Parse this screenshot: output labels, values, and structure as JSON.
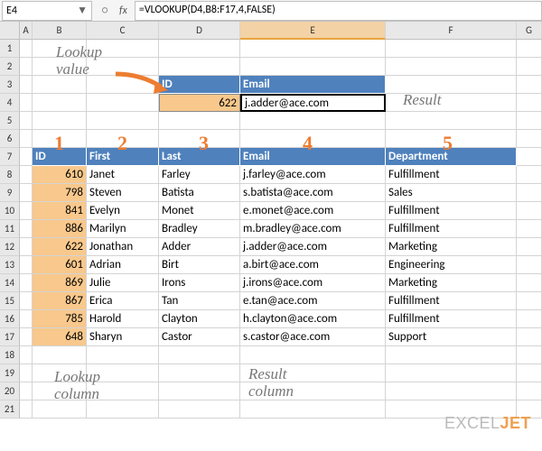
{
  "formula_bar": {
    "cell_ref": "E4",
    "fx_label": "fx",
    "formula": "=VLOOKUP(D4,B8:F17,4,FALSE)"
  },
  "columns": [
    "A",
    "B",
    "C",
    "D",
    "E",
    "F",
    "G"
  ],
  "rows": [
    "1",
    "2",
    "3",
    "4",
    "5",
    "6",
    "7",
    "8",
    "9",
    "10",
    "11",
    "12",
    "13",
    "14",
    "15",
    "16",
    "17",
    "18",
    "19",
    "20",
    "21"
  ],
  "lookup_header": {
    "id": "ID",
    "email": "Email"
  },
  "lookup_row": {
    "id": "622",
    "email": "j.adder@ace.com"
  },
  "table_header": {
    "id": "ID",
    "first": "First",
    "last": "Last",
    "email": "Email",
    "dept": "Department"
  },
  "table_rows": [
    {
      "id": "610",
      "first": "Janet",
      "last": "Farley",
      "email": "j.farley@ace.com",
      "dept": "Fulfillment"
    },
    {
      "id": "798",
      "first": "Steven",
      "last": "Batista",
      "email": "s.batista@ace.com",
      "dept": "Sales"
    },
    {
      "id": "841",
      "first": "Evelyn",
      "last": "Monet",
      "email": "e.monet@ace.com",
      "dept": "Fulfillment"
    },
    {
      "id": "886",
      "first": "Marilyn",
      "last": "Bradley",
      "email": "m.bradley@ace.com",
      "dept": "Fulfillment"
    },
    {
      "id": "622",
      "first": "Jonathan",
      "last": "Adder",
      "email": "j.adder@ace.com",
      "dept": "Marketing"
    },
    {
      "id": "601",
      "first": "Adrian",
      "last": "Birt",
      "email": "a.birt@ace.com",
      "dept": "Engineering"
    },
    {
      "id": "869",
      "first": "Julie",
      "last": "Irons",
      "email": "j.irons@ace.com",
      "dept": "Marketing"
    },
    {
      "id": "867",
      "first": "Erica",
      "last": "Tan",
      "email": "e.tan@ace.com",
      "dept": "Fulfillment"
    },
    {
      "id": "785",
      "first": "Harold",
      "last": "Clayton",
      "email": "h.clayton@ace.com",
      "dept": "Fulfillment"
    },
    {
      "id": "648",
      "first": "Sharyn",
      "last": "Castor",
      "email": "s.castor@ace.com",
      "dept": "Support"
    }
  ],
  "annotations": {
    "lookup_value": "Lookup\nvalue",
    "result": "Result",
    "lookup_column": "Lookup\ncolumn",
    "result_column": "Result\ncolumn",
    "nums": {
      "n1": "1",
      "n2": "2",
      "n3": "3",
      "n4": "4",
      "n5": "5"
    }
  },
  "watermark": {
    "part1": "EXCEL",
    "part2": "JET"
  },
  "chart_data": {
    "type": "table",
    "title": "VLOOKUP example",
    "lookup_value": 622,
    "result": "j.adder@ace.com",
    "columns": [
      "ID",
      "First",
      "Last",
      "Email",
      "Department"
    ],
    "rows": [
      [
        610,
        "Janet",
        "Farley",
        "j.farley@ace.com",
        "Fulfillment"
      ],
      [
        798,
        "Steven",
        "Batista",
        "s.batista@ace.com",
        "Sales"
      ],
      [
        841,
        "Evelyn",
        "Monet",
        "e.monet@ace.com",
        "Fulfillment"
      ],
      [
        886,
        "Marilyn",
        "Bradley",
        "m.bradley@ace.com",
        "Fulfillment"
      ],
      [
        622,
        "Jonathan",
        "Adder",
        "j.adder@ace.com",
        "Marketing"
      ],
      [
        601,
        "Adrian",
        "Birt",
        "a.birt@ace.com",
        "Engineering"
      ],
      [
        869,
        "Julie",
        "Irons",
        "j.irons@ace.com",
        "Marketing"
      ],
      [
        867,
        "Erica",
        "Tan",
        "e.tan@ace.com",
        "Fulfillment"
      ],
      [
        785,
        "Harold",
        "Clayton",
        "h.clayton@ace.com",
        "Fulfillment"
      ],
      [
        648,
        "Sharyn",
        "Castor",
        "s.castor@ace.com",
        "Support"
      ]
    ]
  }
}
